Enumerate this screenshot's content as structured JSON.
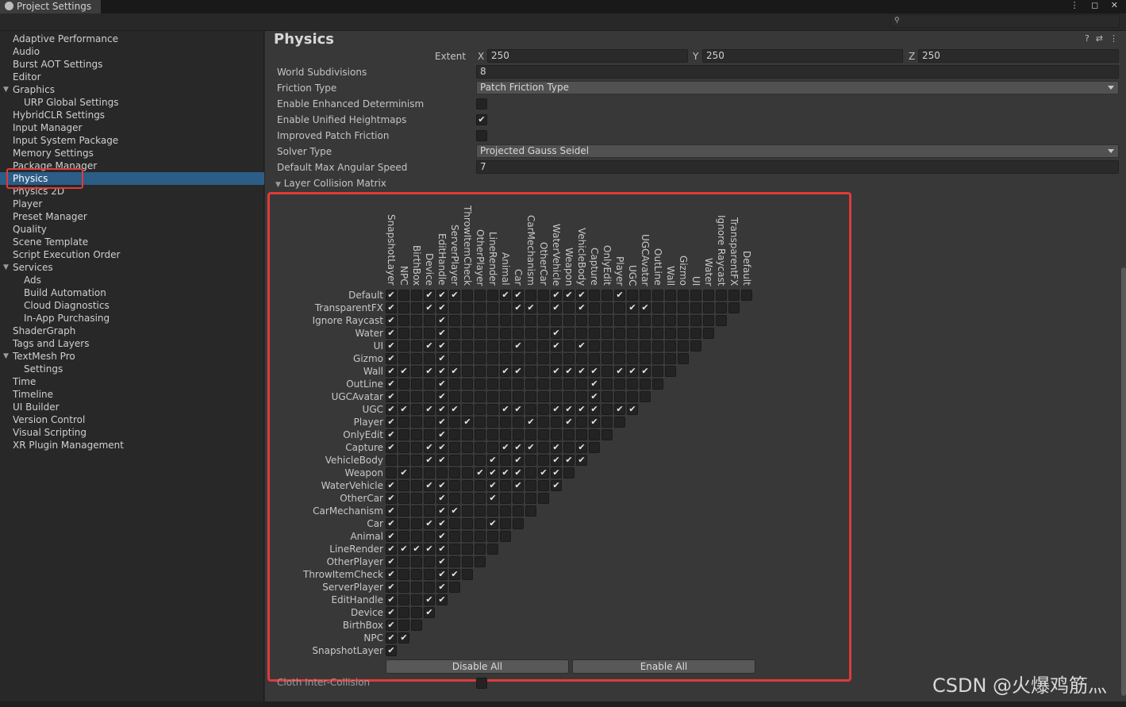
{
  "window": {
    "tab_title": "Project Settings",
    "controls": "⋮ ◻ ✕"
  },
  "sidebar": {
    "items": [
      {
        "label": "Adaptive Performance",
        "indent": 0
      },
      {
        "label": "Audio",
        "indent": 0
      },
      {
        "label": "Burst AOT Settings",
        "indent": 0
      },
      {
        "label": "Editor",
        "indent": 0
      },
      {
        "label": "Graphics",
        "indent": 0,
        "expanded": true
      },
      {
        "label": "URP Global Settings",
        "indent": 1
      },
      {
        "label": "HybridCLR Settings",
        "indent": 0
      },
      {
        "label": "Input Manager",
        "indent": 0
      },
      {
        "label": "Input System Package",
        "indent": 0
      },
      {
        "label": "Memory Settings",
        "indent": 0
      },
      {
        "label": "Package Manager",
        "indent": 0
      },
      {
        "label": "Physics",
        "indent": 0,
        "selected": true
      },
      {
        "label": "Physics 2D",
        "indent": 0
      },
      {
        "label": "Player",
        "indent": 0
      },
      {
        "label": "Preset Manager",
        "indent": 0
      },
      {
        "label": "Quality",
        "indent": 0
      },
      {
        "label": "Scene Template",
        "indent": 0
      },
      {
        "label": "Script Execution Order",
        "indent": 0
      },
      {
        "label": "Services",
        "indent": 0,
        "expanded": true
      },
      {
        "label": "Ads",
        "indent": 1
      },
      {
        "label": "Build Automation",
        "indent": 1
      },
      {
        "label": "Cloud Diagnostics",
        "indent": 1
      },
      {
        "label": "In-App Purchasing",
        "indent": 1
      },
      {
        "label": "ShaderGraph",
        "indent": 0
      },
      {
        "label": "Tags and Layers",
        "indent": 0
      },
      {
        "label": "TextMesh Pro",
        "indent": 0,
        "expanded": true
      },
      {
        "label": "Settings",
        "indent": 1
      },
      {
        "label": "Time",
        "indent": 0
      },
      {
        "label": "Timeline",
        "indent": 0
      },
      {
        "label": "UI Builder",
        "indent": 0
      },
      {
        "label": "Version Control",
        "indent": 0
      },
      {
        "label": "Visual Scripting",
        "indent": 0
      },
      {
        "label": "XR Plugin Management",
        "indent": 0
      }
    ]
  },
  "main": {
    "title": "Physics",
    "extent": {
      "label": "Extent",
      "x_label": "X",
      "x": "250",
      "y_label": "Y",
      "y": "250",
      "z_label": "Z",
      "z": "250"
    },
    "world_subdivisions": {
      "label": "World Subdivisions",
      "value": "8"
    },
    "friction_type": {
      "label": "Friction Type",
      "value": "Patch Friction Type"
    },
    "enhanced_determinism": {
      "label": "Enable Enhanced Determinism",
      "checked": false
    },
    "unified_heightmaps": {
      "label": "Enable Unified Heightmaps",
      "checked": true
    },
    "improved_patch_friction": {
      "label": "Improved Patch Friction",
      "checked": false
    },
    "solver_type": {
      "label": "Solver Type",
      "value": "Projected Gauss Seidel"
    },
    "max_angular_speed": {
      "label": "Default Max Angular Speed",
      "value": "7"
    },
    "layer_matrix_label": "Layer Collision Matrix",
    "disable_all": "Disable All",
    "enable_all": "Enable All",
    "cloth_label": "Cloth Inter-Collision"
  },
  "matrix": {
    "columns": [
      "SnapshotLayer",
      "NPC",
      "BirthBox",
      "Device",
      "EditHandle",
      "ServerPlayer",
      "ThrowItemCheck",
      "OtherPlayer",
      "LineRender",
      "Animal",
      "Car",
      "CarMechanism",
      "OtherCar",
      "WaterVehicle",
      "Weapon",
      "VehicleBody",
      "Capture",
      "OnlyEdit",
      "Player",
      "UGC",
      "UGCAvatar",
      "OutLine",
      "Wall",
      "Gizmo",
      "UI",
      "Water",
      "Ignore Raycast",
      "TransparentFX",
      "Default"
    ],
    "rows": [
      "Default",
      "TransparentFX",
      "Ignore Raycast",
      "Water",
      "UI",
      "Gizmo",
      "Wall",
      "OutLine",
      "UGCAvatar",
      "UGC",
      "Player",
      "OnlyEdit",
      "Capture",
      "VehicleBody",
      "Weapon",
      "WaterVehicle",
      "OtherCar",
      "CarMechanism",
      "Car",
      "Animal",
      "LineRender",
      "OtherPlayer",
      "ThrowItemCheck",
      "ServerPlayer",
      "EditHandle",
      "Device",
      "BirthBox",
      "NPC",
      "SnapshotLayer"
    ],
    "checked": [
      [
        0,
        3,
        4,
        5,
        9,
        10,
        13,
        14,
        15,
        18
      ],
      [
        0,
        3,
        4,
        10,
        11,
        13,
        15,
        19,
        20
      ],
      [
        0,
        4
      ],
      [
        0,
        4,
        13
      ],
      [
        0,
        3,
        4,
        10,
        13,
        15
      ],
      [
        0,
        4
      ],
      [
        0,
        1,
        3,
        4,
        5,
        9,
        10,
        13,
        14,
        15,
        16,
        18,
        19,
        20
      ],
      [
        0,
        4,
        16
      ],
      [
        0,
        4,
        16
      ],
      [
        0,
        1,
        3,
        4,
        5,
        9,
        10,
        13,
        14,
        15,
        16,
        18,
        19
      ],
      [
        0,
        4,
        6,
        11,
        14,
        16
      ],
      [
        0,
        4
      ],
      [
        0,
        3,
        4,
        9,
        10,
        11,
        13,
        15
      ],
      [
        3,
        4,
        8,
        10,
        13,
        14,
        15
      ],
      [
        1,
        7,
        8,
        9,
        10,
        12,
        13
      ],
      [
        0,
        3,
        4,
        8,
        10,
        13
      ],
      [
        0,
        4,
        8
      ],
      [
        0,
        4,
        5
      ],
      [
        0,
        3,
        4,
        8
      ],
      [
        0,
        4
      ],
      [
        0,
        1,
        2,
        3,
        4
      ],
      [
        0,
        4
      ],
      [
        0,
        4,
        5
      ],
      [
        0,
        4
      ],
      [
        0,
        3,
        4
      ],
      [
        0,
        3
      ],
      [
        0
      ],
      [
        0,
        1
      ],
      [
        0
      ]
    ]
  },
  "watermark": "CSDN @火爆鸡筋灬"
}
